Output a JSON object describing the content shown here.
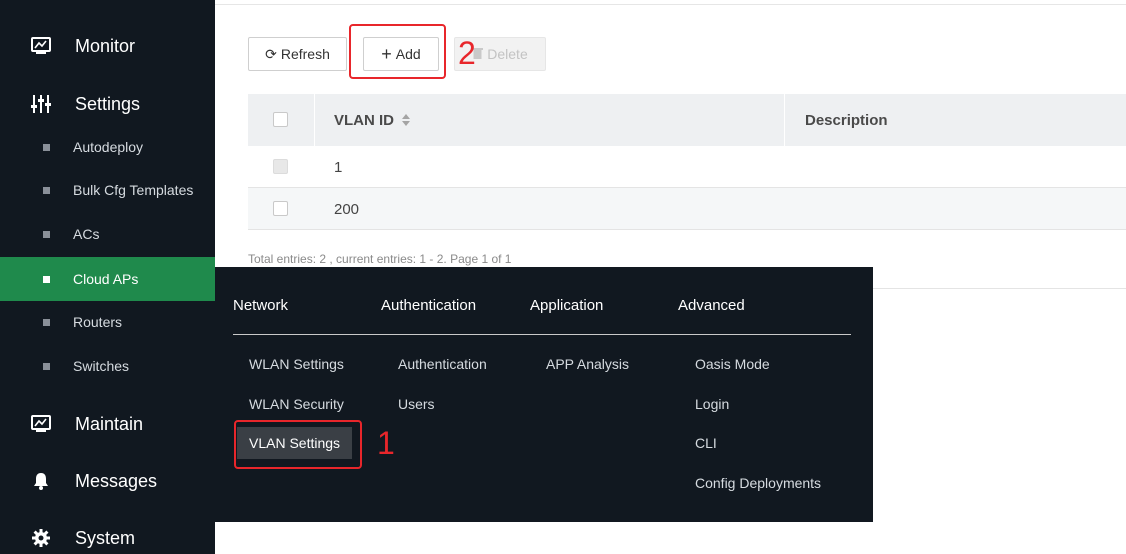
{
  "sidebar": {
    "monitor": {
      "label": "Monitor",
      "icon": "monitor-icon"
    },
    "settings": {
      "label": "Settings",
      "icon": "sliders-icon"
    },
    "sub_items": [
      {
        "label": "Autodeploy"
      },
      {
        "label": "Bulk Cfg Templates"
      },
      {
        "label": "ACs"
      },
      {
        "label": "Cloud APs",
        "active": true
      },
      {
        "label": "Routers"
      },
      {
        "label": "Switches"
      }
    ],
    "maintain": {
      "label": "Maintain",
      "icon": "maintain-icon"
    },
    "messages": {
      "label": "Messages",
      "icon": "bell-icon"
    },
    "system": {
      "label": "System",
      "icon": "gear-icon"
    },
    "active_color": "#1f8a4c"
  },
  "toolbar": {
    "refresh_label": "Refresh",
    "add_label": "Add",
    "delete_label": "Delete"
  },
  "table": {
    "columns": [
      "VLAN ID",
      "Description"
    ],
    "rows": [
      {
        "vlan_id": "1",
        "description": ""
      },
      {
        "vlan_id": "200",
        "description": ""
      }
    ]
  },
  "footer": {
    "summary": "Total entries: 2 , current entries: 1 - 2. Page 1 of 1"
  },
  "mega_menu": {
    "columns": [
      {
        "heading": "Network",
        "items": [
          "WLAN Settings",
          "WLAN Security",
          "VLAN Settings"
        ]
      },
      {
        "heading": "Authentication",
        "items": [
          "Authentication",
          "Users"
        ]
      },
      {
        "heading": "Application",
        "items": [
          "APP Analysis"
        ]
      },
      {
        "heading": "Advanced",
        "items": [
          "Oasis Mode",
          "Login",
          "CLI",
          "Config Deployments"
        ]
      }
    ],
    "selected": "VLAN Settings"
  },
  "annotations": {
    "step1": "1",
    "step2": "2",
    "color": "#e8262b"
  }
}
